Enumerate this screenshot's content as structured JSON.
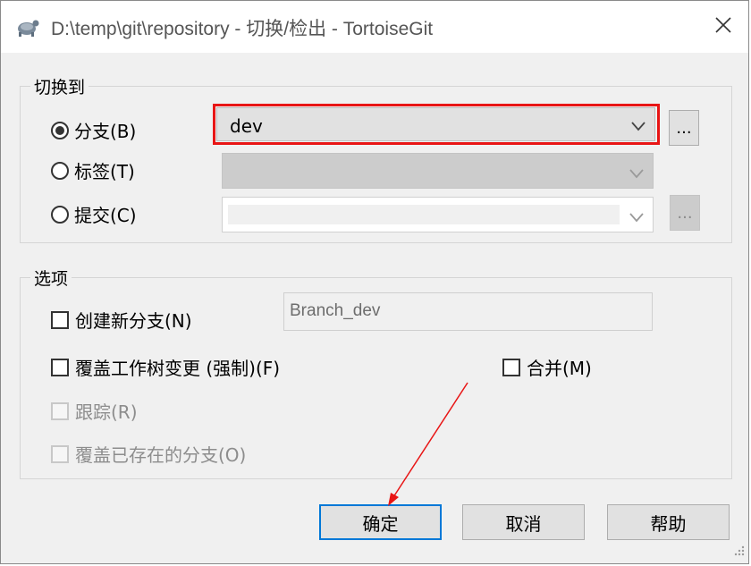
{
  "window": {
    "title": "D:\\temp\\git\\repository - 切换/检出 - TortoiseGit",
    "app_icon": "tortoise-icon",
    "close_icon": "close-icon"
  },
  "switch_to": {
    "group_label": "切换到",
    "branch": {
      "label": "分支(B)",
      "selected": true,
      "value": "dev",
      "browse_label": "..."
    },
    "tag": {
      "label": "标签(T)",
      "selected": false,
      "value": ""
    },
    "commit": {
      "label": "提交(C)",
      "selected": false,
      "value": "",
      "browse_label": "..."
    }
  },
  "options": {
    "group_label": "选项",
    "create_branch": {
      "label": "创建新分支(N)",
      "checked": false,
      "name_value": "Branch_dev"
    },
    "override_changes": {
      "label": "覆盖工作树变更 (强制)(F)",
      "checked": false
    },
    "merge": {
      "label": "合并(M)",
      "checked": false
    },
    "track": {
      "label": "跟踪(R)",
      "checked": false,
      "disabled": true
    },
    "override_branch": {
      "label": "覆盖已存在的分支(O)",
      "checked": false,
      "disabled": true
    }
  },
  "buttons": {
    "ok": "确定",
    "cancel": "取消",
    "help": "帮助"
  },
  "colors": {
    "highlight": "#e81515",
    "arrow": "#e81515",
    "default_button_border": "#0078d7"
  }
}
